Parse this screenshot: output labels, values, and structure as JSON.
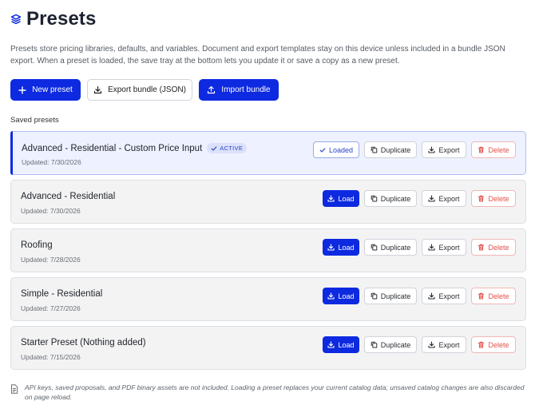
{
  "header": {
    "title": "Presets",
    "icon": "layers-icon"
  },
  "description": "Presets store pricing libraries, defaults, and variables. Document and export templates stay on this device unless included in a bundle JSON export. When a preset is loaded, the save tray at the bottom lets you update it or save a copy as a new preset.",
  "actions": {
    "new_preset": "New preset",
    "export_bundle": "Export bundle (JSON)",
    "import_bundle": "Import bundle"
  },
  "section_label": "Saved presets",
  "buttons": {
    "load": "Load",
    "loaded": "Loaded",
    "duplicate": "Duplicate",
    "export": "Export",
    "delete": "Delete",
    "active_badge": "ACTIVE"
  },
  "presets": [
    {
      "name": "Advanced - Residential - Custom Price Input",
      "updated": "Updated: 7/30/2026",
      "active": true
    },
    {
      "name": "Advanced - Residential",
      "updated": "Updated: 7/30/2026",
      "active": false
    },
    {
      "name": "Roofing",
      "updated": "Updated: 7/28/2026",
      "active": false
    },
    {
      "name": "Simple - Residential",
      "updated": "Updated: 7/27/2026",
      "active": false
    },
    {
      "name": "Starter Preset (Nothing added)",
      "updated": "Updated: 7/15/2026",
      "active": false
    }
  ],
  "footer_note": "API keys, saved proposals, and PDF binary assets are not included. Loading a preset replaces your current catalog data; unsaved catalog changes are also discarded on page reload.",
  "colors": {
    "primary": "#0d2ae0",
    "danger": "#e0524c",
    "active_bg": "#eef1ff"
  }
}
